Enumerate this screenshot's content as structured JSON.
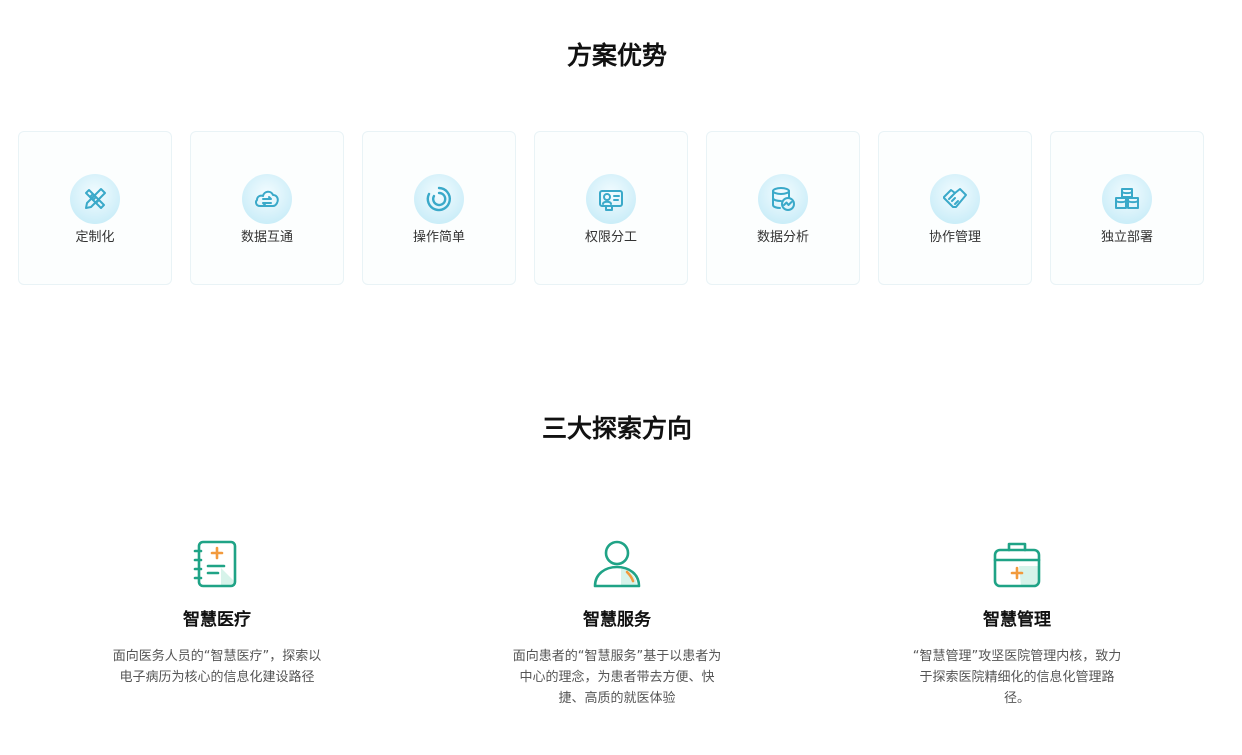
{
  "advantages": {
    "title": "方案优势",
    "items": [
      {
        "label": "定制化",
        "icon": "ruler-pencil-icon"
      },
      {
        "label": "数据互通",
        "icon": "cloud-sync-icon"
      },
      {
        "label": "操作简单",
        "icon": "spiral-icon"
      },
      {
        "label": "权限分工",
        "icon": "id-card-icon"
      },
      {
        "label": "数据分析",
        "icon": "database-chart-icon"
      },
      {
        "label": "协作管理",
        "icon": "handshake-icon"
      },
      {
        "label": "独立部署",
        "icon": "stacked-boxes-icon"
      }
    ]
  },
  "directions": {
    "title": "三大探索方向",
    "items": [
      {
        "title": "智慧医疗",
        "desc": "面向医务人员的“智慧医疗”，探索以电子病历为核心的信息化建设路径",
        "icon": "medical-notebook-icon"
      },
      {
        "title": "智慧服务",
        "desc": "面向患者的“智慧服务”基于以患者为中心的理念，为患者带去方便、快捷、高质的就医体验",
        "icon": "patient-user-icon"
      },
      {
        "title": "智慧管理",
        "desc": "“智慧管理”攻坚医院管理内核，致力于探索医院精细化的信息化管理路径。",
        "icon": "medical-kit-icon"
      }
    ]
  },
  "colors": {
    "icon_blue": "#3aa9c9",
    "icon_green": "#1fa386",
    "icon_orange": "#f29a3d"
  }
}
